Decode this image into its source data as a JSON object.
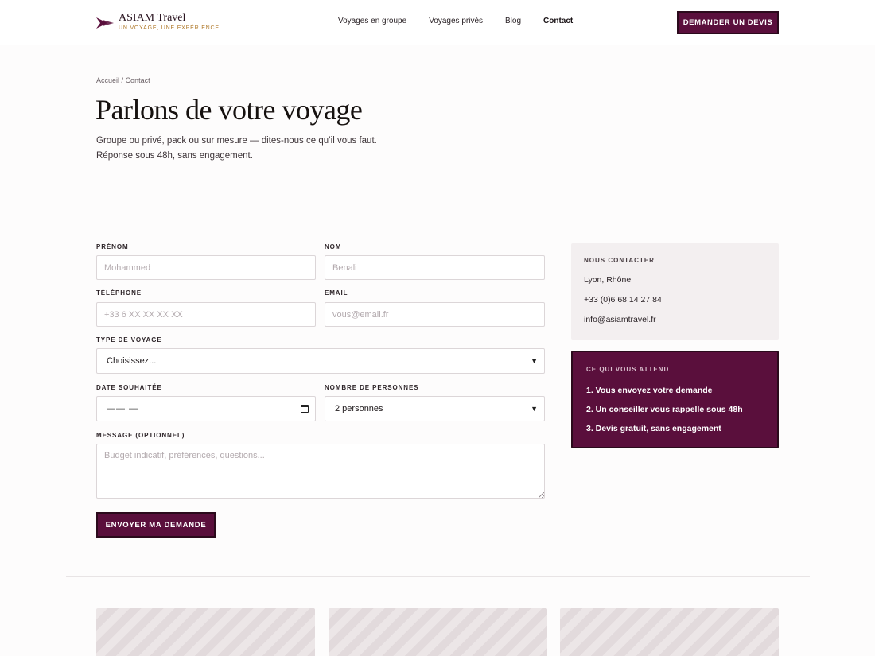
{
  "brand": {
    "name": "ASIAM Travel",
    "tagline": "UN VOYAGE, UNE EXPÉRIENCE"
  },
  "nav": {
    "items": [
      {
        "label": "Voyages en groupe"
      },
      {
        "label": "Voyages privés"
      },
      {
        "label": "Blog"
      },
      {
        "label": "Contact"
      }
    ],
    "active": "Contact",
    "cta": "DEMANDER UN DEVIS"
  },
  "breadcrumb": {
    "home": "Accueil",
    "separator": "/",
    "current": "Contact"
  },
  "hero": {
    "title": "Parlons de votre voyage",
    "intro": "Groupe ou privé, pack ou sur mesure — dites-nous ce qu’il vous faut. Réponse sous 48h, sans engagement."
  },
  "form": {
    "firstname": {
      "label": "PRÉNOM",
      "placeholder": "Mohammed"
    },
    "lastname": {
      "label": "NOM",
      "placeholder": "Benali"
    },
    "phone": {
      "label": "TÉLÉPHONE",
      "placeholder": "+33 6 XX XX XX XX"
    },
    "email": {
      "label": "EMAIL",
      "placeholder": "vous@email.fr"
    },
    "trip_type": {
      "label": "TYPE DE VOYAGE",
      "value": "Choisissez..."
    },
    "date": {
      "label": "DATE SOUHAITÉE",
      "value": "—— —"
    },
    "people": {
      "label": "NOMBRE DE PERSONNES",
      "value": "2 personnes"
    },
    "message": {
      "label": "MESSAGE (OPTIONNEL)",
      "placeholder": "Budget indicatif, préférences, questions..."
    },
    "submit": "ENVOYER MA DEMANDE"
  },
  "contact_card": {
    "heading": "NOUS CONTACTER",
    "location": "Lyon, Rhône",
    "phone": "+33 (0)6 68 14 27 84",
    "email": "info@asiamtravel.fr"
  },
  "steps_card": {
    "heading": "CE QUI VOUS ATTEND",
    "steps": [
      "1. Vous envoyez votre demande",
      "2. Un conseiller vous rappelle sous 48h",
      "3. Devis gratuit, sans engagement"
    ]
  },
  "colors": {
    "brand": "#5a0f3c",
    "accent": "#b07a2c",
    "card_bg": "#f3eff0"
  }
}
